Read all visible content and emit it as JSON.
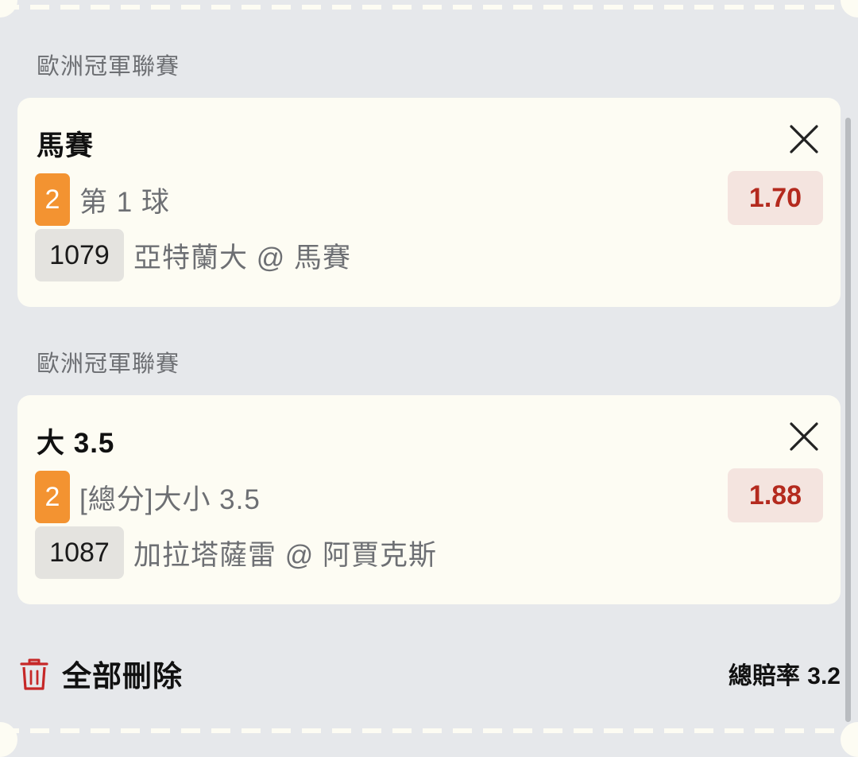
{
  "bets": [
    {
      "league": "歐洲冠軍聯賽",
      "title": "馬賽",
      "quantity": "2",
      "market": "第 1 球",
      "odds": "1.70",
      "match_no": "1079",
      "teams": "亞特蘭大 @ 馬賽"
    },
    {
      "league": "歐洲冠軍聯賽",
      "title": "大 3.5",
      "quantity": "2",
      "market": "[總分]大小 3.5",
      "odds": "1.88",
      "match_no": "1087",
      "teams": "加拉塔薩雷 @ 阿賈克斯"
    }
  ],
  "footer": {
    "delete_all_label": "全部刪除",
    "total_odds_label": "總賠率",
    "total_odds_value": "3.2"
  },
  "icons": {
    "close": "close-icon",
    "trash": "trash-icon"
  },
  "colors": {
    "quantity_badge": "#f39331",
    "odds_text": "#b42a1e",
    "odds_bg": "#f4e4df",
    "trash_icon": "#c62828"
  }
}
